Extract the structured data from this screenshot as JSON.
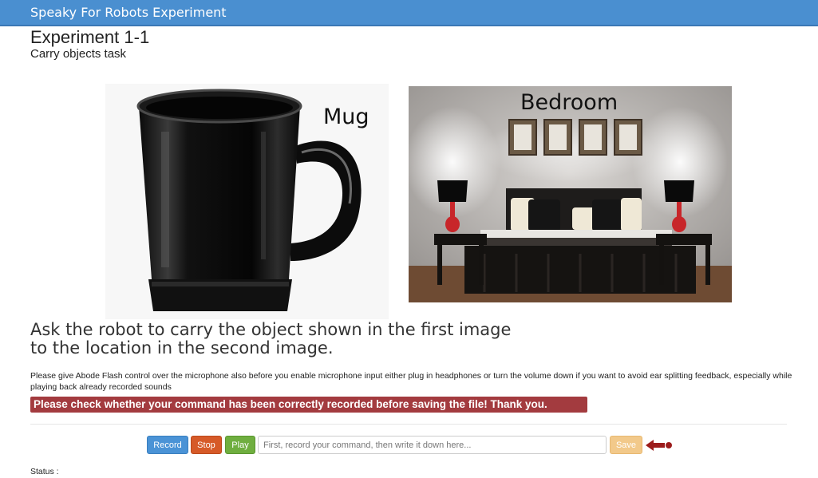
{
  "navbar": {
    "brand": "Speaky For Robots Experiment"
  },
  "header": {
    "title": "Experiment 1-1",
    "subtitle": "Carry objects task"
  },
  "images": {
    "object_label": "Mug",
    "location_label": "Bedroom"
  },
  "instruction": {
    "line1": "Ask the robot to carry the object shown in the first image",
    "line2": "to the location in the second image."
  },
  "note": "Please give Abode Flash control over the microphone also before you enable microphone input either plug in headphones or turn the volume down if you want to avoid ear splitting feedback, especially while playing back already recorded sounds",
  "warning": "Please check whether your command has been correctly recorded before saving the file! Thank you.",
  "controls": {
    "record_label": "Record",
    "stop_label": "Stop",
    "play_label": "Play",
    "command_placeholder": "First, record your command, then write it down here...",
    "command_value": "",
    "save_label": "Save"
  },
  "status": {
    "label": "Status :"
  },
  "colors": {
    "navbar": "#4a8fd0",
    "record": "#4a93d6",
    "stop": "#d65a28",
    "play": "#6fae3f",
    "save": "#f2c98a",
    "warning": "#a33b3f"
  },
  "icons": {
    "save_pointer": "arrow-left-icon"
  }
}
